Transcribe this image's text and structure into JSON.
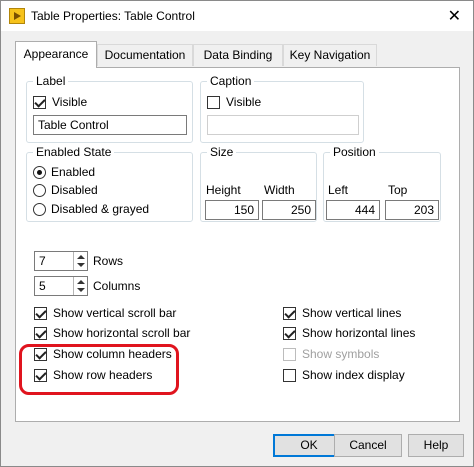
{
  "window": {
    "title": "Table Properties: Table Control"
  },
  "tabs": [
    "Appearance",
    "Documentation",
    "Data Binding",
    "Key Navigation"
  ],
  "label_group": {
    "legend": "Label",
    "visible_label": "Visible",
    "visible_checked": true,
    "text_value": "Table Control"
  },
  "caption_group": {
    "legend": "Caption",
    "visible_label": "Visible",
    "visible_checked": false,
    "text_value": ""
  },
  "enabled_state": {
    "legend": "Enabled State",
    "options": [
      "Enabled",
      "Disabled",
      "Disabled & grayed"
    ],
    "selected": "Enabled"
  },
  "size_group": {
    "legend": "Size",
    "height_label": "Height",
    "width_label": "Width",
    "height_value": "150",
    "width_value": "250"
  },
  "position_group": {
    "legend": "Position",
    "left_label": "Left",
    "top_label": "Top",
    "left_value": "444",
    "top_value": "203"
  },
  "rows": {
    "value": "7",
    "label": "Rows"
  },
  "columns": {
    "value": "5",
    "label": "Columns"
  },
  "left_options": [
    {
      "label": "Show vertical scroll bar",
      "checked": true
    },
    {
      "label": "Show horizontal scroll bar",
      "checked": true
    },
    {
      "label": "Show column headers",
      "checked": true
    },
    {
      "label": "Show row headers",
      "checked": true
    }
  ],
  "right_options": [
    {
      "label": "Show vertical lines",
      "checked": true,
      "disabled": false
    },
    {
      "label": "Show horizontal lines",
      "checked": true,
      "disabled": false
    },
    {
      "label": "Show symbols",
      "checked": false,
      "disabled": true
    },
    {
      "label": "Show index display",
      "checked": false,
      "disabled": false
    }
  ],
  "buttons": {
    "ok": "OK",
    "cancel": "Cancel",
    "help": "Help"
  },
  "colors": {
    "highlight": "#e0141e",
    "focus_border": "#0078d7"
  }
}
